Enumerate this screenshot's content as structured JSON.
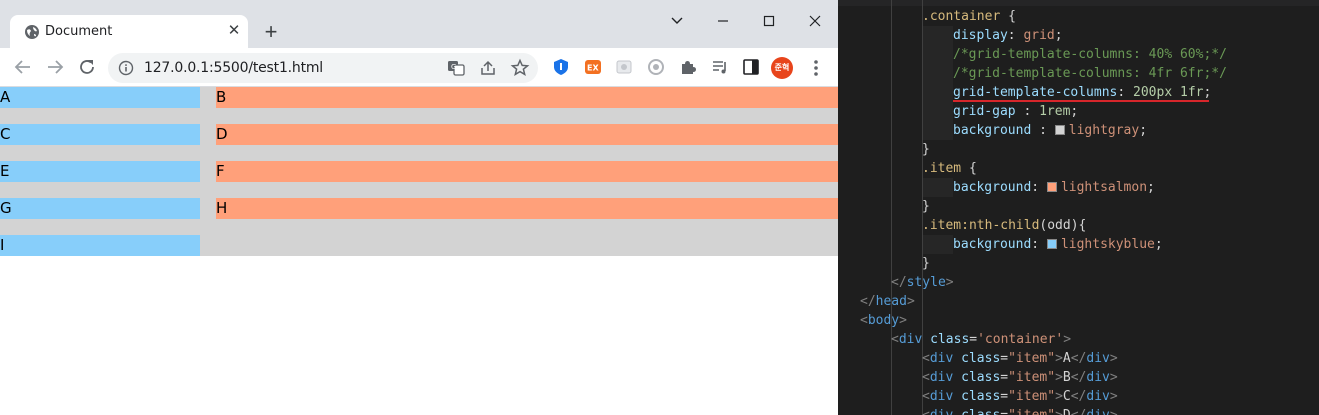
{
  "browser": {
    "tab_title": "Document",
    "url": "127.0.0.1:5500/test1.html",
    "profile_label": "준혁"
  },
  "page": {
    "items": [
      "A",
      "B",
      "C",
      "D",
      "E",
      "F",
      "G",
      "H",
      "I"
    ]
  },
  "editor": {
    "lines": [
      [
        {
          "c": "sel",
          "t": ".container "
        },
        {
          "c": "txt",
          "t": "{"
        }
      ],
      [
        {
          "c": "prop",
          "t": "display"
        },
        {
          "c": "txt",
          "t": ": "
        },
        {
          "c": "val",
          "t": "grid"
        },
        {
          "c": "txt",
          "t": ";"
        }
      ],
      [
        {
          "c": "cmt",
          "t": "/*grid-template-columns: 40% 60%;*/"
        }
      ],
      [
        {
          "c": "cmt",
          "t": "/*grid-template-columns: 4fr 6fr;*/"
        }
      ],
      [
        {
          "c": "prop",
          "t": "grid-template-columns"
        },
        {
          "c": "txt",
          "t": ": "
        },
        {
          "c": "num",
          "t": "200px"
        },
        {
          "c": "txt",
          "t": " "
        },
        {
          "c": "num",
          "t": "1fr"
        },
        {
          "c": "txt",
          "t": ";"
        }
      ],
      [
        {
          "c": "prop",
          "t": "grid-gap"
        },
        {
          "c": "txt",
          "t": " : "
        },
        {
          "c": "num",
          "t": "1rem"
        },
        {
          "c": "txt",
          "t": ";"
        }
      ],
      [
        {
          "c": "prop",
          "t": "background"
        },
        {
          "c": "txt",
          "t": " : "
        },
        {
          "c": "swatch",
          "t": "#d3d3d3"
        },
        {
          "c": "val",
          "t": "lightgray"
        },
        {
          "c": "txt",
          "t": ";"
        }
      ],
      [
        {
          "c": "txt",
          "t": "}"
        }
      ],
      [
        {
          "c": "sel",
          "t": ".item "
        },
        {
          "c": "txt",
          "t": "{"
        }
      ],
      [
        {
          "c": "prop",
          "t": "background"
        },
        {
          "c": "txt",
          "t": ": "
        },
        {
          "c": "swatch",
          "t": "#ffa07a"
        },
        {
          "c": "val",
          "t": "lightsalmon"
        },
        {
          "c": "txt",
          "t": ";"
        }
      ],
      [
        {
          "c": "txt",
          "t": "}"
        }
      ],
      [
        {
          "c": "sel",
          "t": ".item:nth-child"
        },
        {
          "c": "txt",
          "t": "(odd){"
        }
      ],
      [
        {
          "c": "prop",
          "t": "background"
        },
        {
          "c": "txt",
          "t": ": "
        },
        {
          "c": "swatch",
          "t": "#87cefa"
        },
        {
          "c": "val",
          "t": "lightskyblue"
        },
        {
          "c": "txt",
          "t": ";"
        }
      ],
      [
        {
          "c": "txt",
          "t": "}"
        }
      ],
      [
        {
          "c": "pun",
          "t": "</"
        },
        {
          "c": "tag",
          "t": "style"
        },
        {
          "c": "pun",
          "t": ">"
        }
      ],
      [
        {
          "c": "pun",
          "t": "</"
        },
        {
          "c": "tag",
          "t": "head"
        },
        {
          "c": "pun",
          "t": ">"
        }
      ],
      [
        {
          "c": "pun",
          "t": "<"
        },
        {
          "c": "tag",
          "t": "body"
        },
        {
          "c": "pun",
          "t": ">"
        }
      ],
      [
        {
          "c": "pun",
          "t": "<"
        },
        {
          "c": "tag",
          "t": "div"
        },
        {
          "c": "txt",
          "t": " "
        },
        {
          "c": "attr",
          "t": "class"
        },
        {
          "c": "txt",
          "t": "="
        },
        {
          "c": "val",
          "t": "'container'"
        },
        {
          "c": "pun",
          "t": ">"
        }
      ],
      [
        {
          "c": "pun",
          "t": "<"
        },
        {
          "c": "tag",
          "t": "div"
        },
        {
          "c": "txt",
          "t": " "
        },
        {
          "c": "attr",
          "t": "class"
        },
        {
          "c": "txt",
          "t": "="
        },
        {
          "c": "val",
          "t": "\"item\""
        },
        {
          "c": "pun",
          "t": ">"
        },
        {
          "c": "txt",
          "t": "A"
        },
        {
          "c": "pun",
          "t": "</"
        },
        {
          "c": "tag",
          "t": "div"
        },
        {
          "c": "pun",
          "t": ">"
        }
      ],
      [
        {
          "c": "pun",
          "t": "<"
        },
        {
          "c": "tag",
          "t": "div"
        },
        {
          "c": "txt",
          "t": " "
        },
        {
          "c": "attr",
          "t": "class"
        },
        {
          "c": "txt",
          "t": "="
        },
        {
          "c": "val",
          "t": "\"item\""
        },
        {
          "c": "pun",
          "t": ">"
        },
        {
          "c": "txt",
          "t": "B"
        },
        {
          "c": "pun",
          "t": "</"
        },
        {
          "c": "tag",
          "t": "div"
        },
        {
          "c": "pun",
          "t": ">"
        }
      ],
      [
        {
          "c": "pun",
          "t": "<"
        },
        {
          "c": "tag",
          "t": "div"
        },
        {
          "c": "txt",
          "t": " "
        },
        {
          "c": "attr",
          "t": "class"
        },
        {
          "c": "txt",
          "t": "="
        },
        {
          "c": "val",
          "t": "\"item\""
        },
        {
          "c": "pun",
          "t": ">"
        },
        {
          "c": "txt",
          "t": "C"
        },
        {
          "c": "pun",
          "t": "</"
        },
        {
          "c": "tag",
          "t": "div"
        },
        {
          "c": "pun",
          "t": ">"
        }
      ],
      [
        {
          "c": "pun",
          "t": "<"
        },
        {
          "c": "tag",
          "t": "div"
        },
        {
          "c": "txt",
          "t": " "
        },
        {
          "c": "attr",
          "t": "class"
        },
        {
          "c": "txt",
          "t": "="
        },
        {
          "c": "val",
          "t": "\"item\""
        },
        {
          "c": "pun",
          "t": ">"
        },
        {
          "c": "txt",
          "t": "D"
        },
        {
          "c": "pun",
          "t": "</"
        },
        {
          "c": "tag",
          "t": "div"
        },
        {
          "c": "pun",
          "t": ">"
        }
      ]
    ]
  }
}
